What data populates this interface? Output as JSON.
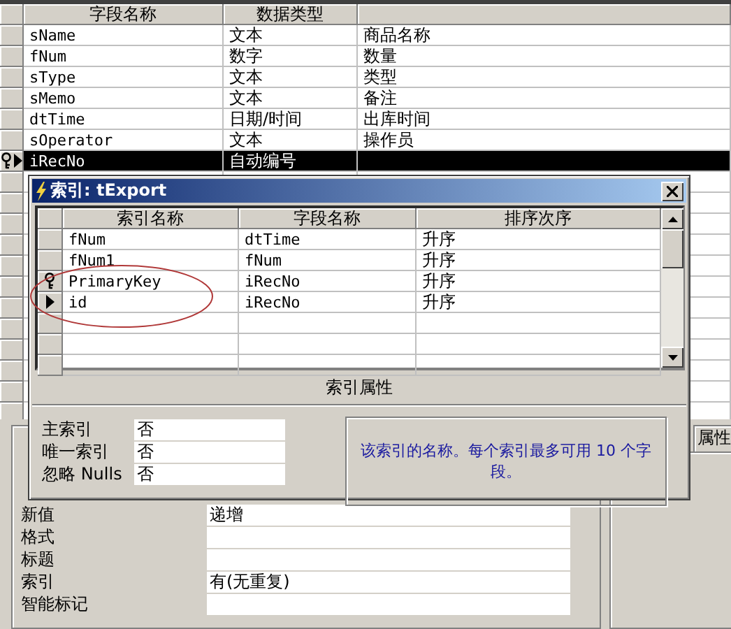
{
  "fields_table": {
    "columns": [
      "字段名称",
      "数据类型"
    ],
    "rows": [
      {
        "name": "sName",
        "type": "文本",
        "description": "商品名称",
        "selected": false,
        "primary_key": false
      },
      {
        "name": "fNum",
        "type": "数字",
        "description": "数量",
        "selected": false,
        "primary_key": false
      },
      {
        "name": "sType",
        "type": "文本",
        "description": "类型",
        "selected": false,
        "primary_key": false
      },
      {
        "name": "sMemo",
        "type": "文本",
        "description": "备注",
        "selected": false,
        "primary_key": false
      },
      {
        "name": "dtTime",
        "type": "日期/时间",
        "description": "出库时间",
        "selected": false,
        "primary_key": false
      },
      {
        "name": "sOperator",
        "type": "文本",
        "description": "操作员",
        "selected": false,
        "primary_key": false
      },
      {
        "name": "iRecNo",
        "type": "自动编号",
        "description": "",
        "selected": true,
        "primary_key": true
      }
    ]
  },
  "index_dialog": {
    "title": "索引: tExport",
    "columns": [
      "索引名称",
      "字段名称",
      "排序次序"
    ],
    "rows": [
      {
        "index_name": "fNum",
        "field_name": "dtTime",
        "sort_order": "升序",
        "primary_key": false,
        "current": false
      },
      {
        "index_name": "fNum1",
        "field_name": "fNum",
        "sort_order": "升序",
        "primary_key": false,
        "current": false
      },
      {
        "index_name": "PrimaryKey",
        "field_name": "iRecNo",
        "sort_order": "升序",
        "primary_key": true,
        "current": false
      },
      {
        "index_name": "id",
        "field_name": "iRecNo",
        "sort_order": "升序",
        "primary_key": false,
        "current": true
      }
    ],
    "properties_heading": "索引属性",
    "properties": [
      {
        "label": "主索引",
        "value": "否"
      },
      {
        "label": "唯一索引",
        "value": "否"
      },
      {
        "label": "忽略 Nulls",
        "value": "否"
      }
    ],
    "help_text": "该索引的名称。每个索引最多可用 10 个字段。"
  },
  "field_properties": {
    "rows": [
      {
        "label": "新值",
        "value": "递增"
      },
      {
        "label": "格式",
        "value": ""
      },
      {
        "label": "标题",
        "value": ""
      },
      {
        "label": "索引",
        "value": "有(无重复)"
      },
      {
        "label": "智能标记",
        "value": ""
      }
    ],
    "side_tab": "属性"
  }
}
